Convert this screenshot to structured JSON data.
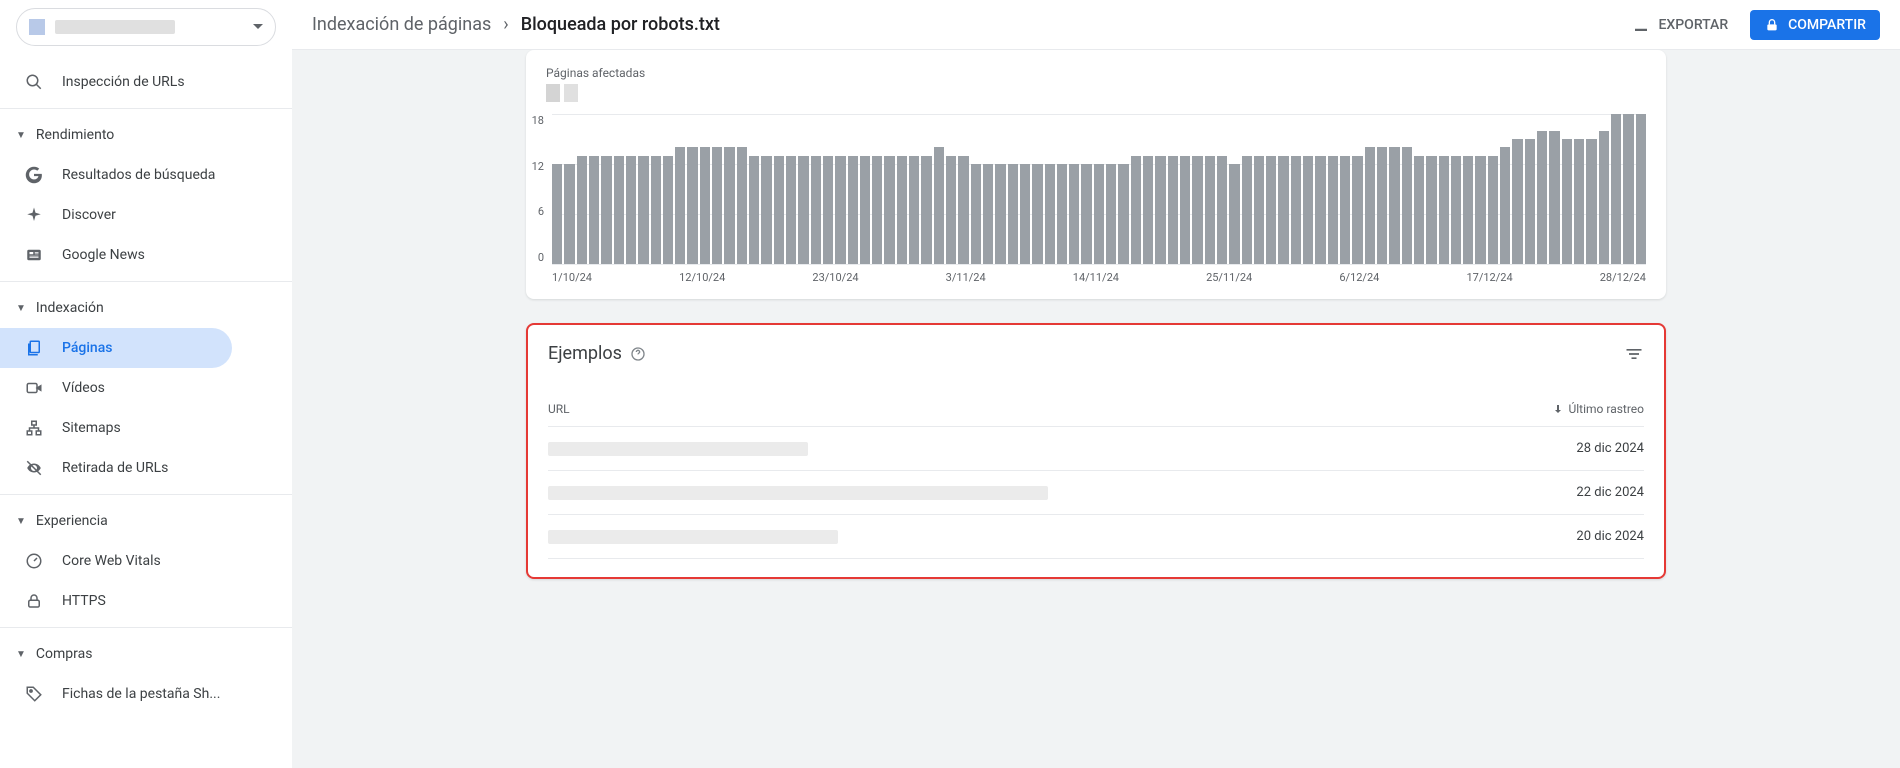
{
  "header": {
    "breadcrumb_parent": "Indexación de páginas",
    "breadcrumb_current": "Bloqueada por robots.txt",
    "export_label": "EXPORTAR",
    "share_label": "COMPARTIR"
  },
  "sidebar": {
    "inspect_url": "Inspección de URLs",
    "sections": {
      "rendimiento": "Rendimiento",
      "indexacion": "Indexación",
      "experiencia": "Experiencia",
      "compras": "Compras"
    },
    "items": {
      "resultados": "Resultados de búsqueda",
      "discover": "Discover",
      "google_news": "Google News",
      "paginas": "Páginas",
      "videos": "Vídeos",
      "sitemaps": "Sitemaps",
      "retirada": "Retirada de URLs",
      "cwv": "Core Web Vitals",
      "https": "HTTPS",
      "fichas": "Fichas de la pestaña Sh..."
    }
  },
  "chart": {
    "title": "Páginas afectadas"
  },
  "chart_data": {
    "type": "bar",
    "title": "Páginas afectadas",
    "xlabel": "",
    "ylabel": "",
    "ylim": [
      0,
      18
    ],
    "y_ticks": [
      18,
      12,
      6,
      0
    ],
    "x_ticks": [
      "1/10/24",
      "12/10/24",
      "23/10/24",
      "3/11/24",
      "14/11/24",
      "25/11/24",
      "6/12/24",
      "17/12/24",
      "28/12/24"
    ],
    "categories": [
      "1/10",
      "2/10",
      "3/10",
      "4/10",
      "5/10",
      "6/10",
      "7/10",
      "8/10",
      "9/10",
      "10/10",
      "11/10",
      "12/10",
      "13/10",
      "14/10",
      "15/10",
      "16/10",
      "17/10",
      "18/10",
      "19/10",
      "20/10",
      "21/10",
      "22/10",
      "23/10",
      "24/10",
      "25/10",
      "26/10",
      "27/10",
      "28/10",
      "29/10",
      "30/10",
      "31/10",
      "1/11",
      "2/11",
      "3/11",
      "4/11",
      "5/11",
      "6/11",
      "7/11",
      "8/11",
      "9/11",
      "10/11",
      "11/11",
      "12/11",
      "13/11",
      "14/11",
      "15/11",
      "16/11",
      "17/11",
      "18/11",
      "19/11",
      "20/11",
      "21/11",
      "22/11",
      "23/11",
      "24/11",
      "25/11",
      "26/11",
      "27/11",
      "28/11",
      "29/11",
      "30/11",
      "1/12",
      "2/12",
      "3/12",
      "4/12",
      "5/12",
      "6/12",
      "7/12",
      "8/12",
      "9/12",
      "10/12",
      "11/12",
      "12/12",
      "13/12",
      "14/12",
      "15/12",
      "16/12",
      "17/12",
      "18/12",
      "19/12",
      "20/12",
      "21/12",
      "22/12",
      "23/12",
      "24/12",
      "25/12",
      "26/12",
      "27/12",
      "28/12"
    ],
    "values": [
      12,
      12,
      13,
      13,
      13,
      13,
      13,
      13,
      13,
      13,
      14,
      14,
      14,
      14,
      14,
      14,
      13,
      13,
      13,
      13,
      13,
      13,
      13,
      13,
      13,
      13,
      13,
      13,
      13,
      13,
      13,
      14,
      13,
      13,
      12,
      12,
      12,
      12,
      12,
      12,
      12,
      12,
      12,
      12,
      12,
      12,
      12,
      13,
      13,
      13,
      13,
      13,
      13,
      13,
      13,
      12,
      13,
      13,
      13,
      13,
      13,
      13,
      13,
      13,
      13,
      13,
      14,
      14,
      14,
      14,
      13,
      13,
      13,
      13,
      13,
      13,
      13,
      14,
      15,
      15,
      16,
      16,
      15,
      15,
      15,
      16,
      18,
      18,
      18
    ]
  },
  "examples": {
    "title": "Ejemplos",
    "col_url": "URL",
    "col_date": "Último rastreo",
    "rows": [
      {
        "date": "28 dic 2024",
        "url_width": 260
      },
      {
        "date": "22 dic 2024",
        "url_width": 500
      },
      {
        "date": "20 dic 2024",
        "url_width": 290
      }
    ]
  }
}
